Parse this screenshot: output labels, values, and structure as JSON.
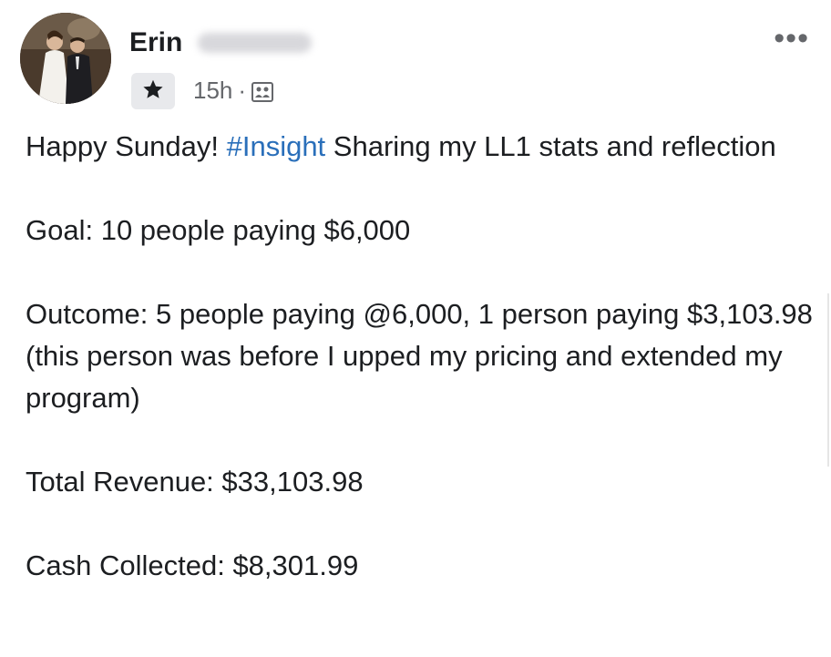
{
  "post": {
    "author_name": "Erin",
    "time": "15h",
    "separator": "·",
    "more_label": "•••",
    "intro_before": "Happy Sunday! ",
    "hashtag": "#Insight",
    "intro_after": " Sharing my LL1 stats and reflection",
    "goal": "Goal: 10 people paying $6,000",
    "outcome": "Outcome: 5 people paying @6,000, 1 person paying $3,103.98 (this person was before I upped my pricing and extended my program)",
    "revenue": "Total Revenue: $33,103.98",
    "cash": "Cash Collected: $8,301.99"
  },
  "icons": {
    "badge": "star-icon",
    "audience": "group-icon",
    "more": "more-options-icon"
  },
  "colors": {
    "hashtag": "#2a6fba",
    "meta_text": "#65676b",
    "badge_bg": "#e8e9ec"
  }
}
